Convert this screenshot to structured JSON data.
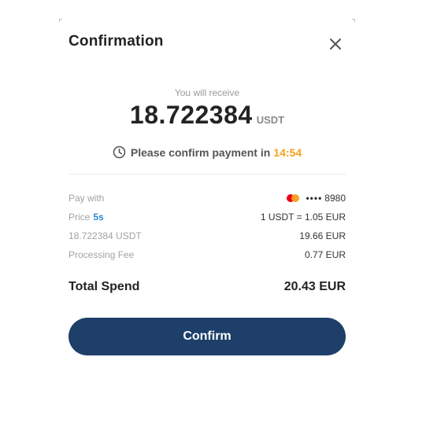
{
  "modal": {
    "title": "Confirmation",
    "receive_label": "You will receive",
    "amount": "18.722384",
    "amount_unit": "USDT",
    "timer_text": "Please confirm payment in",
    "countdown": "14:54"
  },
  "details": {
    "pay_with_label": "Pay with",
    "card_dots": "••••",
    "card_last4": "8980",
    "price_label": "Price",
    "price_refresh": "5s",
    "price_value": "1 USDT = 1.05 EUR",
    "subtotal_label": "18.722384 USDT",
    "subtotal_value": "19.66 EUR",
    "fee_label": "Processing Fee",
    "fee_value": "0.77 EUR"
  },
  "total": {
    "label": "Total Spend",
    "value": "20.43 EUR"
  },
  "actions": {
    "confirm_label": "Confirm"
  },
  "icons": {
    "close": "close-icon",
    "clock": "clock-icon",
    "card": "mastercard-icon"
  },
  "colors": {
    "accent_countdown": "#f5a21b",
    "price_badge": "#2a8ad4",
    "button_bg": "#1e3f6a"
  }
}
